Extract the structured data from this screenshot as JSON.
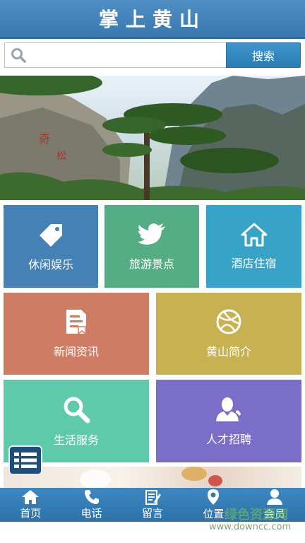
{
  "header": {
    "title": "掌上黄山"
  },
  "search": {
    "placeholder": "",
    "value": "",
    "button_label": "搜索"
  },
  "banner": {
    "dots": 3,
    "active_dot": 2
  },
  "tiles": [
    {
      "label": "休闲娱乐",
      "icon": "tag-icon",
      "color": "#4681b6"
    },
    {
      "label": "旅游景点",
      "icon": "bird-icon",
      "color": "#54ad84"
    },
    {
      "label": "酒店住宿",
      "icon": "home-icon",
      "color": "#37a3c6"
    },
    {
      "label": "新闻资讯",
      "icon": "news-icon",
      "color": "#cf7c64"
    },
    {
      "label": "黄山简介",
      "icon": "ball-icon",
      "color": "#c7b150"
    },
    {
      "label": "生活服务",
      "icon": "search-icon",
      "color": "#5fcaa9"
    },
    {
      "label": "人才招聘",
      "icon": "person-icon",
      "color": "#7b6ec8"
    }
  ],
  "tabbar": [
    {
      "label": "首页",
      "icon": "home-icon"
    },
    {
      "label": "电话",
      "icon": "phone-icon"
    },
    {
      "label": "留言",
      "icon": "note-icon"
    },
    {
      "label": "位置",
      "icon": "location-pin-icon"
    },
    {
      "label": "会员",
      "icon": "user-icon"
    }
  ],
  "watermark": {
    "site": "www.downcc.com",
    "text": "绿色资源网"
  }
}
